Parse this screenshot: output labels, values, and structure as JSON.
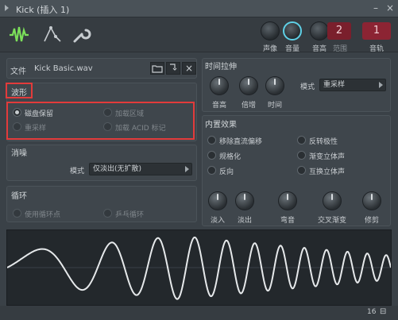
{
  "window": {
    "title": "Kick (插入 1)"
  },
  "toolbar": {
    "labels": {
      "pan": "声像",
      "volume": "音量",
      "pitch": "音高",
      "range_num": "2",
      "range": "范围",
      "track_num": "1",
      "track": "音轨"
    }
  },
  "file": {
    "label": "文件",
    "name": "Kick Basic.wav"
  },
  "waveform": {
    "title": "波形",
    "options": {
      "disk": "磁盘保留",
      "load_regions": "加载区域",
      "resample": "重采样",
      "load_acid": "加载 ACID 标记"
    }
  },
  "declick": {
    "title": "消噪",
    "mode_label": "模式",
    "mode_value": "仅淡出(无扩散)"
  },
  "loop": {
    "title": "循环",
    "use_loop": "使用循环点",
    "pingpong": "乒乓循环"
  },
  "time_stretch": {
    "title": "时间拉伸",
    "knobs": {
      "pitch": "音高",
      "mul": "倍增",
      "time": "时间"
    },
    "mode_label": "模式",
    "mode_value": "重采样"
  },
  "effects": {
    "title": "内置效果",
    "options": {
      "remove_dc": "移除直流偏移",
      "reverse_polarity": "反转极性",
      "normalize": "规格化",
      "fade_stereo": "渐变立体声",
      "reverse": "反向",
      "swap_stereo": "互换立体声"
    },
    "knobs": {
      "fade_in": "淡入",
      "fade_out": "淡出",
      "sweep": "弯音",
      "crossfade": "交叉渐变",
      "trim": "修剪"
    }
  },
  "status": {
    "number": "16"
  },
  "colors": {
    "accent_red": "#e23b3b",
    "knob_ring": "#5fd0e6",
    "wave": "#e6e9eb"
  }
}
